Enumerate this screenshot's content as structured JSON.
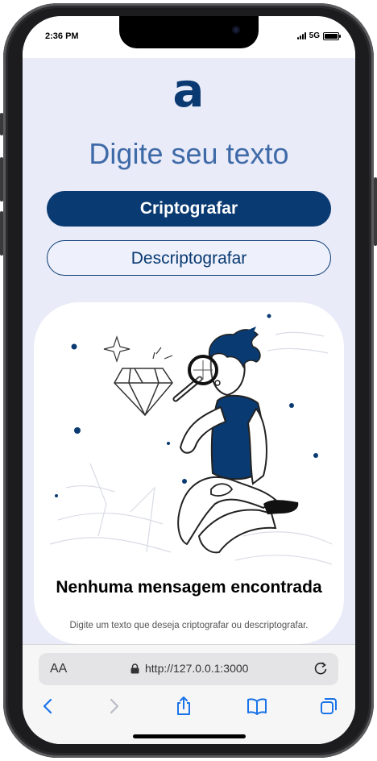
{
  "status_bar": {
    "time": "2:36 PM",
    "network": "5G"
  },
  "app": {
    "title": "Digite seu texto",
    "encrypt_button": "Criptografar",
    "decrypt_button": "Descriptografar",
    "empty_state": {
      "title": "Nenhuma mensagem encontrada",
      "subtitle": "Digite um texto que deseja criptografar ou descriptografar."
    }
  },
  "browser": {
    "text_size_label": "AA",
    "url": "http://127.0.0.1:3000",
    "toolbar": [
      "back-icon",
      "forward-icon",
      "share-icon",
      "bookmarks-icon",
      "tabs-icon"
    ]
  },
  "colors": {
    "primary": "#0a3a72",
    "title": "#3f6aa8",
    "background": "#e9ebf8",
    "toolbar_icon": "#1a73e8"
  }
}
